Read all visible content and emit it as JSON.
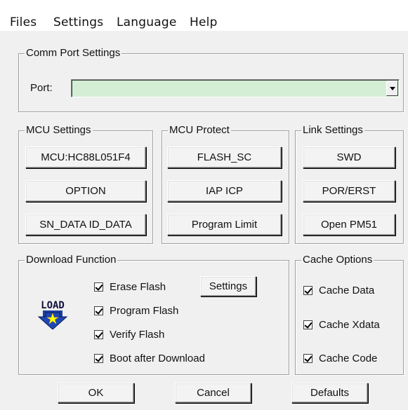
{
  "menu": {
    "files": "Files",
    "settings": "Settings",
    "language": "Language",
    "help": "Help"
  },
  "comm_port": {
    "title": "Comm Port Settings",
    "port_label": "Port:",
    "port_value": "",
    "field_color": "#d3eed5"
  },
  "mcu_settings": {
    "title": "MCU Settings",
    "mcu_button": "MCU:HC88L051F4",
    "option_button": "OPTION",
    "sn_button": "SN_DATA ID_DATA"
  },
  "mcu_protect": {
    "title": "MCU Protect",
    "flash_sc": "FLASH_SC",
    "iap_icp": "IAP ICP",
    "program_limit": "Program Limit"
  },
  "link_settings": {
    "title": "Link Settings",
    "swd": "SWD",
    "por_erst": "POR/ERST",
    "open_pm51": "Open PM51"
  },
  "download": {
    "title": "Download Function",
    "icon": "load-icon",
    "icon_text": "LOAD",
    "settings_button": "Settings",
    "erase_flash": {
      "label": "Erase Flash",
      "checked": true
    },
    "program_flash": {
      "label": "Program Flash",
      "checked": true
    },
    "verify_flash": {
      "label": "Verify Flash",
      "checked": true
    },
    "boot_after": {
      "label": "Boot after Download",
      "checked": true
    }
  },
  "cache": {
    "title": "Cache Options",
    "cache_data": {
      "label": "Cache Data",
      "checked": true
    },
    "cache_xdata": {
      "label": "Cache Xdata",
      "checked": true
    },
    "cache_code": {
      "label": "Cache Code",
      "checked": true
    }
  },
  "footer": {
    "ok": "OK",
    "cancel": "Cancel",
    "defaults": "Defaults"
  }
}
